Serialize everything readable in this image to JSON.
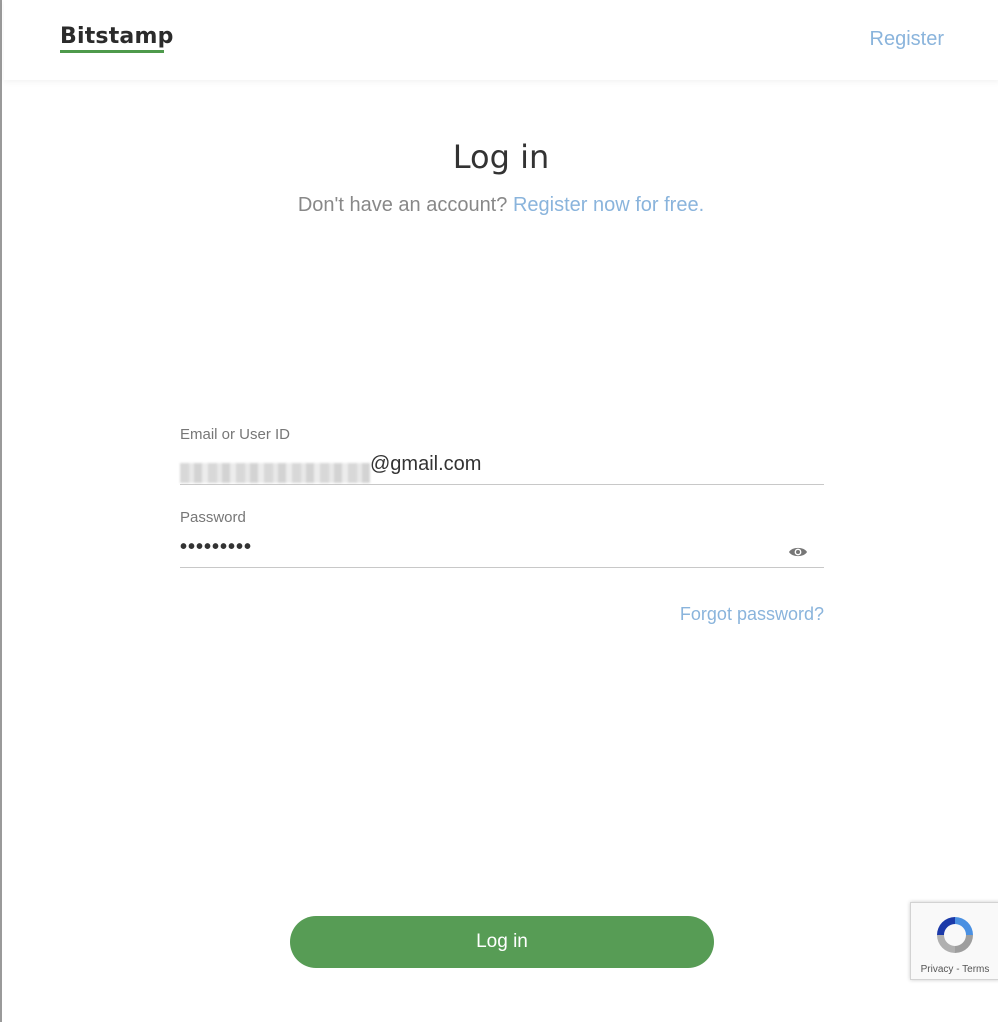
{
  "header": {
    "logo_text": "Bitstamp",
    "register_link": "Register"
  },
  "main": {
    "title": "Log in",
    "subtitle_prefix": "Don't have an account?",
    "subtitle_link": "Register now for free."
  },
  "form": {
    "email_label": "Email or User ID",
    "email_value_visible": "@gmail.com",
    "password_label": "Password",
    "password_value": "•••••••••",
    "forgot_password": "Forgot password?",
    "submit_label": "Log in"
  },
  "recaptcha": {
    "privacy": "Privacy",
    "separator": " - ",
    "terms": "Terms"
  },
  "colors": {
    "brand_green": "#579c55",
    "link_blue": "#8ab4dc",
    "text_dark": "#333333",
    "text_muted": "#888888"
  }
}
